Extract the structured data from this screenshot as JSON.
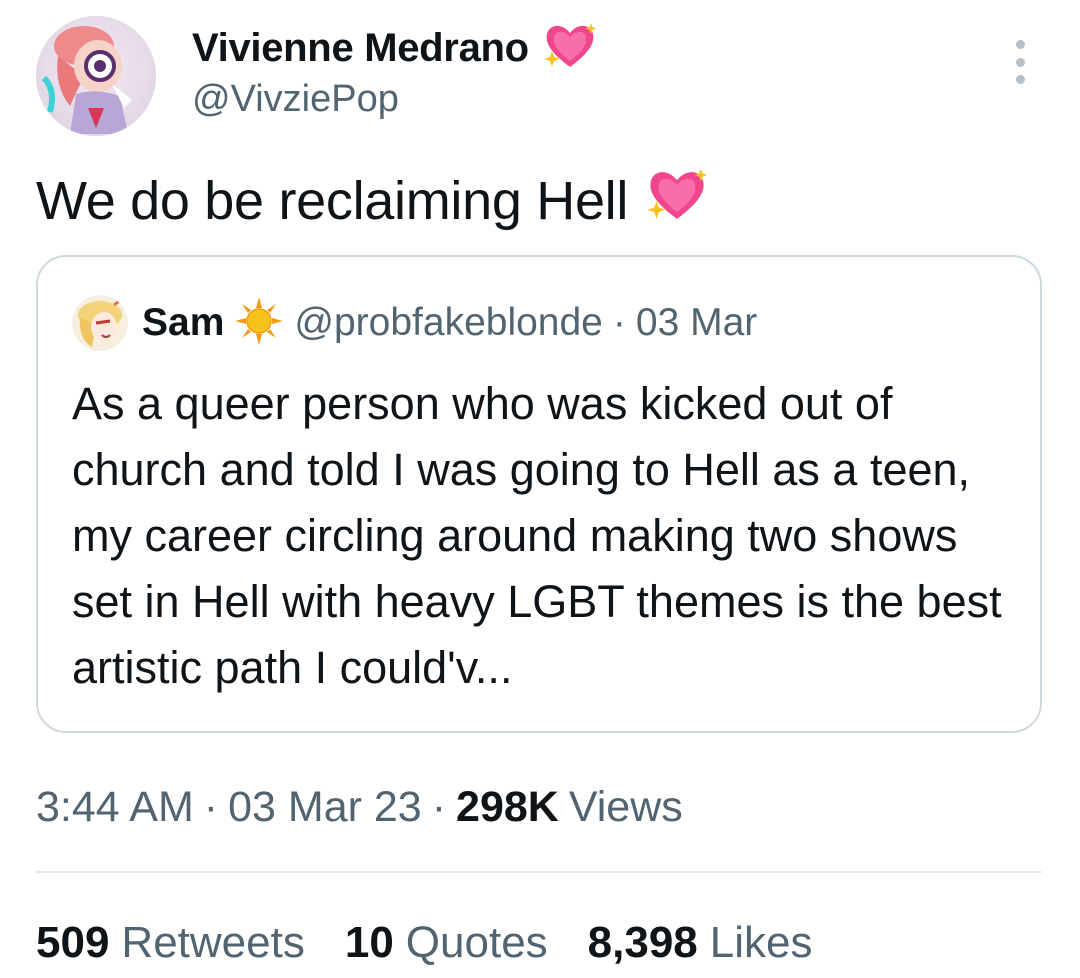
{
  "author": {
    "display_name": "Vivienne Medrano",
    "handle": "@VivziePop",
    "badge_icon": "sparkling-heart-icon"
  },
  "tweet": {
    "text": "We do be reclaiming Hell",
    "emoji_icon": "sparkling-heart-icon"
  },
  "quoted_tweet": {
    "name": "Sam",
    "name_icon": "sun-icon",
    "handle": "@probfakeblonde",
    "separator": "·",
    "date": "03 Mar",
    "text": "As a queer person who was kicked out of church and told I was going to Hell as a teen, my career circling around making two shows set in Hell with heavy LGBT themes is the best artistic path I could'v..."
  },
  "meta": {
    "time": "3:44 AM",
    "separator": "·",
    "date": "03 Mar 23",
    "views_count": "298K",
    "views_label": "Views"
  },
  "stats": {
    "retweets_count": "509",
    "retweets_label": "Retweets",
    "quotes_count": "10",
    "quotes_label": "Quotes",
    "likes_count": "8,398",
    "likes_label": "Likes"
  },
  "colors": {
    "text_primary": "#0f1419",
    "text_secondary": "#536471",
    "border": "#cfd9de",
    "heart_pink": "#f0468c",
    "sparkle_yellow": "#f8c21d"
  }
}
